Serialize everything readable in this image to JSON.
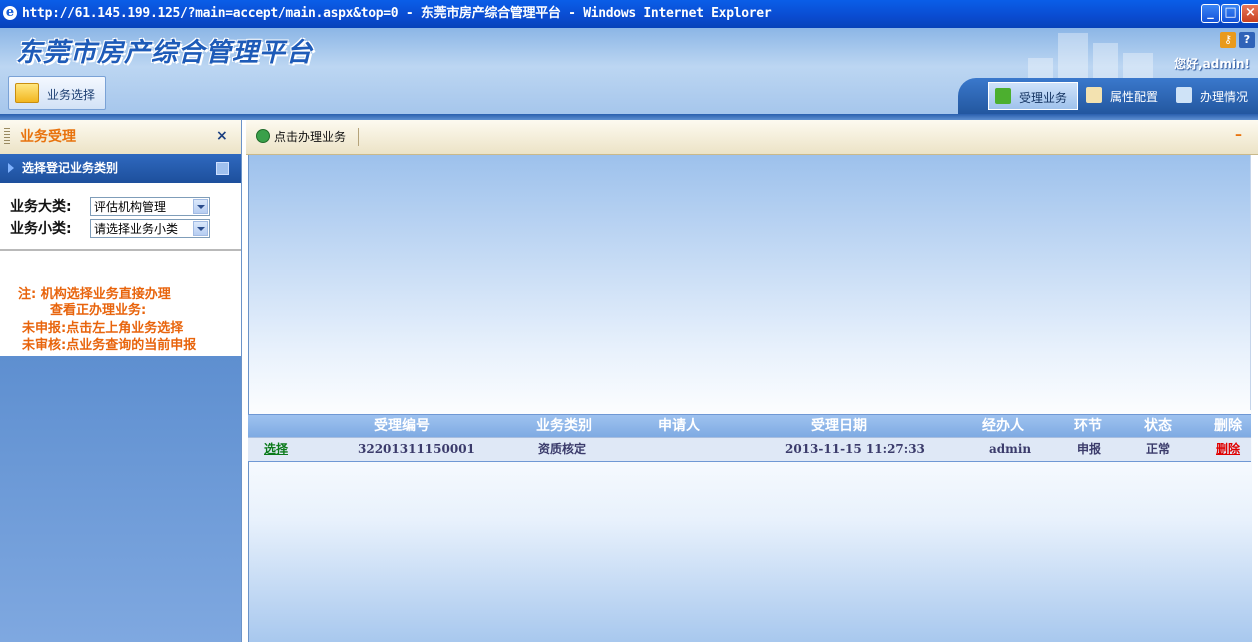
{
  "window": {
    "title": "http://61.145.199.125/?main=accept/main.aspx&top=0 - 东莞市房产综合管理平台 - Windows Internet Explorer",
    "controls": [
      "minimize",
      "maximize",
      "close"
    ]
  },
  "header": {
    "app_title": "东莞市房产综合管理平台",
    "greeting": "您好,admin!",
    "biz_select_label": "业务选择",
    "help_icons": [
      "key-icon",
      "help-icon"
    ]
  },
  "top_tabs": [
    {
      "label": "受理业务",
      "icon": "leaf-icon",
      "active": true
    },
    {
      "label": "属性配置",
      "icon": "pen-paper-icon",
      "active": false
    },
    {
      "label": "办理情况",
      "icon": "chart-book-icon",
      "active": false
    }
  ],
  "sidebar": {
    "title": "业务受理",
    "close_glyph": "×",
    "section_title": "选择登记业务类别",
    "form": {
      "major_label": "业务大类:",
      "major_value": "评估机构管理",
      "minor_label": "业务小类:",
      "minor_value": "请选择业务小类"
    },
    "notes": [
      "注: 机构选择业务直接办理",
      "查看正办理业务:",
      "未申报:点击左上角业务选择",
      "未审核:点业务查询的当前申报"
    ]
  },
  "toolbar": {
    "action_label": "点击办理业务",
    "minimize_glyph": "–"
  },
  "table": {
    "headers": [
      "受理编号",
      "业务类别",
      "申请人",
      "受理日期",
      "经办人",
      "环节",
      "状态",
      "删除"
    ],
    "rows": [
      {
        "select": "选择",
        "number": "32201311150001",
        "category": "资质核定",
        "applicant": "",
        "date": "2013-11-15 11:27:33",
        "handler": "admin",
        "stage": "申报",
        "status": "正常",
        "delete": "删除"
      }
    ]
  },
  "colors": {
    "title_bar": "#0a4bd0",
    "orange_accent": "#e8720c",
    "link_green": "#0a7a1a",
    "delete_red": "#e00000",
    "header_blue": "#7da9e2"
  }
}
